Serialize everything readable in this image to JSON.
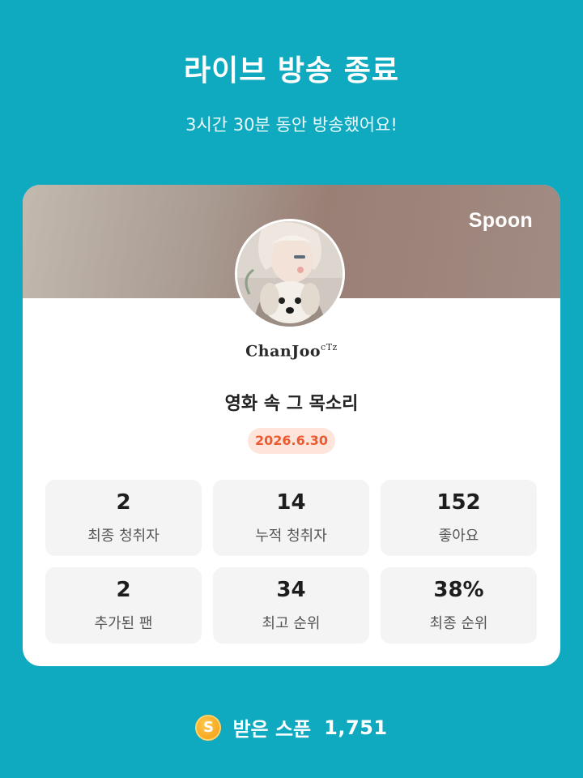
{
  "header": {
    "title": "라이브 방송 종료",
    "subtitle": "3시간 30분 동안 방송했어요!"
  },
  "card": {
    "brand": "Spoon",
    "username": "ChanJoo",
    "username_suffix": "cTz",
    "broadcast_title": "영화 속 그 목소리",
    "date": "2026.6.30",
    "stats": [
      {
        "value": "2",
        "label": "최종 청취자"
      },
      {
        "value": "14",
        "label": "누적 청취자"
      },
      {
        "value": "152",
        "label": "좋아요"
      },
      {
        "value": "2",
        "label": "추가된 팬"
      },
      {
        "value": "34",
        "label": "최고 순위"
      },
      {
        "value": "38%",
        "label": "최종 순위"
      }
    ]
  },
  "footer": {
    "coin_symbol": "S",
    "spoons_label": "받은 스푼",
    "spoons_count": "1,751"
  },
  "colors": {
    "background": "#0fa9c0",
    "date_badge_text": "#ee5a2f",
    "date_badge_bg": "#fde5dc",
    "coin": "#f59a10"
  }
}
